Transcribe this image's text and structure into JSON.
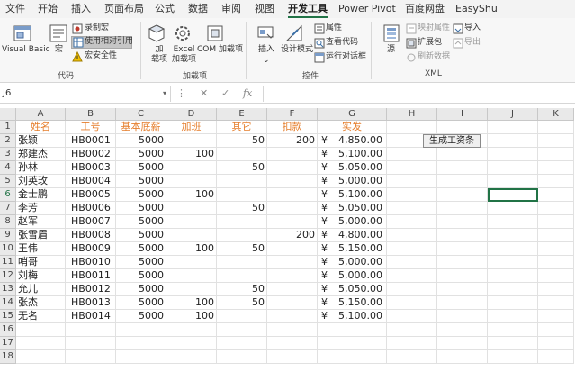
{
  "menu_tabs": [
    "文件",
    "开始",
    "插入",
    "页面布局",
    "公式",
    "数据",
    "审阅",
    "视图",
    "开发工具",
    "Power Pivot",
    "百度网盘",
    "EasyShu"
  ],
  "active_tab": "开发工具",
  "ribbon": {
    "code": {
      "visual_basic": "Visual Basic",
      "macros": "宏",
      "record_macro": "录制宏",
      "relative_refs": "使用相对引用",
      "macro_security": "宏安全性",
      "group": "代码"
    },
    "addins": {
      "addins": "加\n载项",
      "excel_addins": "Excel\n加载项",
      "com_addins": "COM 加载项",
      "group": "加载项"
    },
    "controls": {
      "insert": "插入",
      "design_mode": "设计模式",
      "properties": "属性",
      "view_code": "查看代码",
      "run_dialog": "运行对话框",
      "group": "控件"
    },
    "xml": {
      "source": "源",
      "map_properties": "映射属性",
      "expansion_packs": "扩展包",
      "refresh_data": "刷新数据",
      "import": "导入",
      "export": "导出",
      "group": "XML"
    }
  },
  "formula_bar": {
    "name_box": "J6",
    "cancel": "✕",
    "enter": "✓",
    "fx": "fx",
    "value": ""
  },
  "columns": [
    "A",
    "B",
    "C",
    "D",
    "E",
    "F",
    "G",
    "H",
    "I",
    "J",
    "K"
  ],
  "rows": [
    "1",
    "2",
    "3",
    "4",
    "5",
    "6",
    "7",
    "8",
    "9",
    "10",
    "11",
    "12",
    "13",
    "14",
    "15",
    "16",
    "17",
    "18"
  ],
  "header_row": [
    "姓名",
    "工号",
    "基本底薪",
    "加班",
    "其它",
    "扣款",
    "实发"
  ],
  "table": [
    [
      "张颖",
      "HB0001",
      "5000",
      "",
      "50",
      "200",
      "4,850.00"
    ],
    [
      "郑建杰",
      "HB0002",
      "5000",
      "100",
      "",
      "",
      "5,100.00"
    ],
    [
      "孙林",
      "HB0003",
      "5000",
      "",
      "50",
      "",
      "5,050.00"
    ],
    [
      "刘英玫",
      "HB0004",
      "5000",
      "",
      "",
      "",
      "5,000.00"
    ],
    [
      "金士鹏",
      "HB0005",
      "5000",
      "100",
      "",
      "",
      "5,100.00"
    ],
    [
      "李芳",
      "HB0006",
      "5000",
      "",
      "50",
      "",
      "5,050.00"
    ],
    [
      "赵军",
      "HB0007",
      "5000",
      "",
      "",
      "",
      "5,000.00"
    ],
    [
      "张雪眉",
      "HB0008",
      "5000",
      "",
      "",
      "200",
      "4,800.00"
    ],
    [
      "王伟",
      "HB0009",
      "5000",
      "100",
      "50",
      "",
      "5,150.00"
    ],
    [
      "哨哥",
      "HB0010",
      "5000",
      "",
      "",
      "",
      "5,000.00"
    ],
    [
      "刘梅",
      "HB0011",
      "5000",
      "",
      "",
      "",
      "5,000.00"
    ],
    [
      "允儿",
      "HB0012",
      "5000",
      "",
      "50",
      "",
      "5,050.00"
    ],
    [
      "张杰",
      "HB0013",
      "5000",
      "100",
      "50",
      "",
      "5,150.00"
    ],
    [
      "无名",
      "HB0014",
      "5000",
      "100",
      "",
      "",
      "5,100.00"
    ]
  ],
  "currency_symbol": "¥",
  "generate_button": "生成工资条",
  "colors": {
    "header_text": "#e57e2c",
    "accent": "#217346"
  }
}
